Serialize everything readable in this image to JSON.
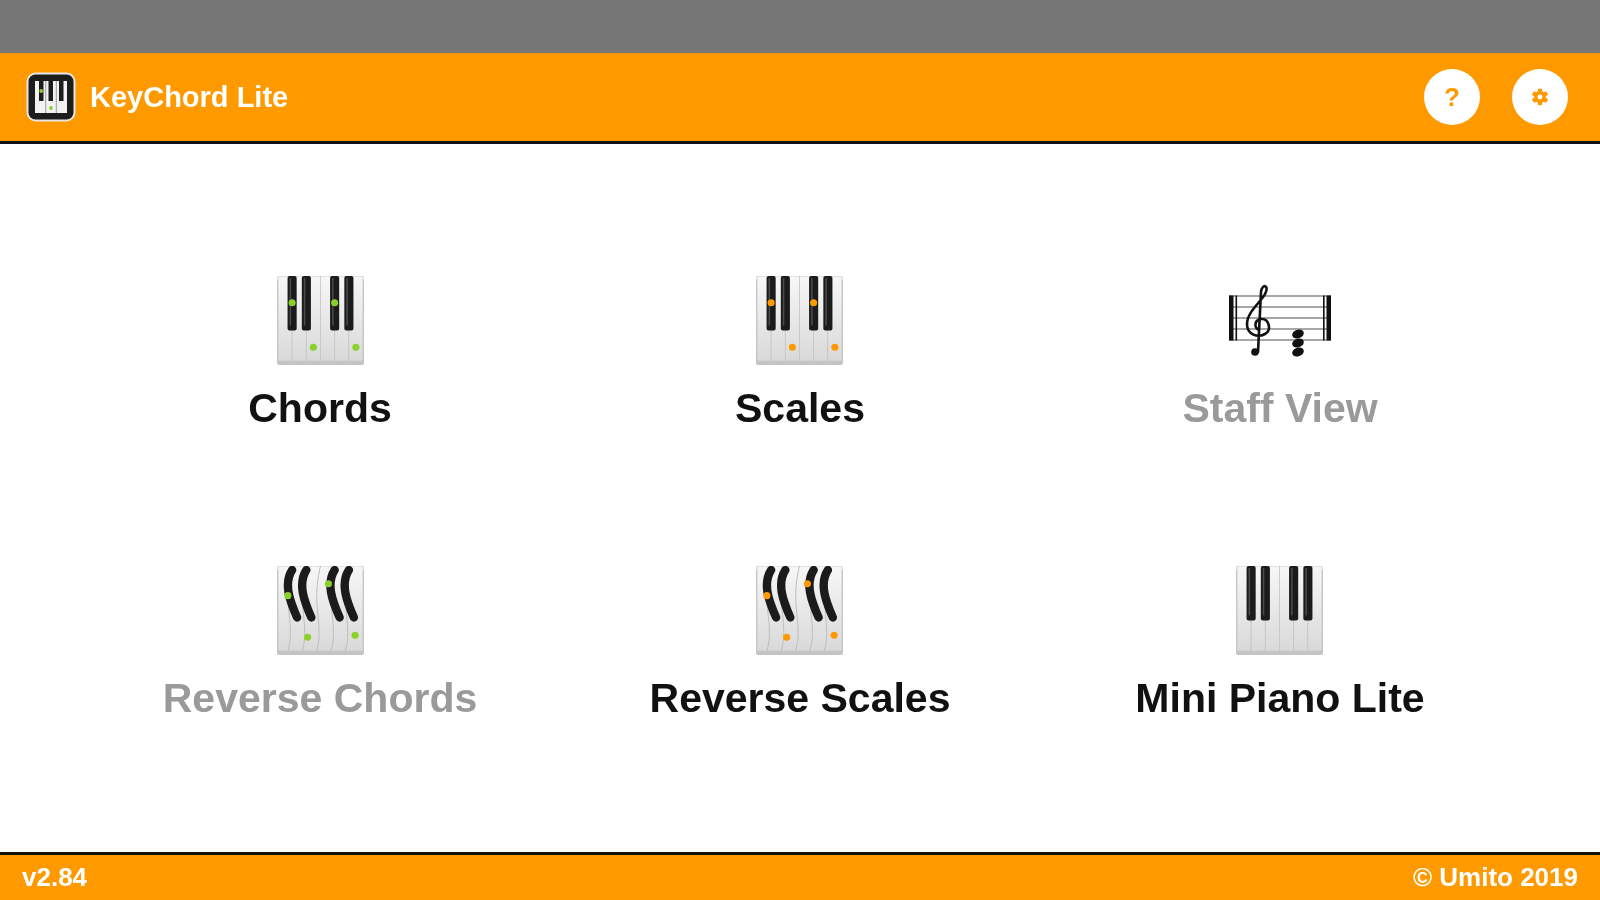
{
  "app_bar": {
    "title": "KeyChord Lite",
    "help_button": "?"
  },
  "menu": [
    {
      "label": "Chords",
      "kind": "keys",
      "color": "#8ad12a",
      "disabled": false
    },
    {
      "label": "Scales",
      "kind": "keys",
      "color": "#ff9900",
      "disabled": false
    },
    {
      "label": "Staff View",
      "kind": "staff",
      "disabled": true
    },
    {
      "label": "Reverse Chords",
      "kind": "wavy-keys",
      "color": "#8ad12a",
      "disabled": true
    },
    {
      "label": "Reverse Scales",
      "kind": "wavy-keys",
      "color": "#ff9900",
      "disabled": false
    },
    {
      "label": "Mini Piano Lite",
      "kind": "keys",
      "disabled": false
    }
  ],
  "footer": {
    "version": "v2.84",
    "copyright": "© Umito 2019"
  }
}
